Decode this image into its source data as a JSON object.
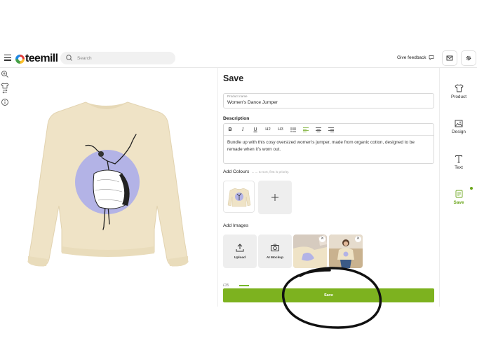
{
  "header": {
    "logo_text": "teemill",
    "search_placeholder": "Search",
    "feedback_label": "Give feedback"
  },
  "icons": {
    "menu": "hamburger-icon",
    "search": "search-icon",
    "feedback": "chat-bubble-icon",
    "mail": "mail-icon",
    "settings": "gear-icon",
    "zoom": "zoom-in-icon",
    "product_swap": "tshirt-swap-icon",
    "info": "info-icon"
  },
  "panel": {
    "title": "Save",
    "product_name_label": "Product name",
    "product_name_value": "Women's Dance Jumper",
    "description_label": "Description",
    "toolbar": [
      "B",
      "I",
      "U",
      "H2",
      "H3"
    ],
    "description_text": "Bundle up with this cosy oversized women's jumper, made from organic cotton, designed to be remade when it's worn out.",
    "colours_label": "Add Colours",
    "colours_hint": "←→ to sort, first is priority.",
    "images_label": "Add Images",
    "upload_label": "Upload",
    "ai_mockup_label": "AI Mockup",
    "price_text": "£35",
    "save_button": "Save"
  },
  "nav": {
    "items": [
      {
        "label": "Product",
        "icon": "tshirt-icon"
      },
      {
        "label": "Design",
        "icon": "image-icon"
      },
      {
        "label": "Text",
        "icon": "text-icon"
      },
      {
        "label": "Save",
        "icon": "save-icon",
        "active": true
      }
    ]
  },
  "colors": {
    "accent_green": "#7db21f",
    "garment_cream": "#efe3c6",
    "design_circle": "#b3b3e6"
  }
}
